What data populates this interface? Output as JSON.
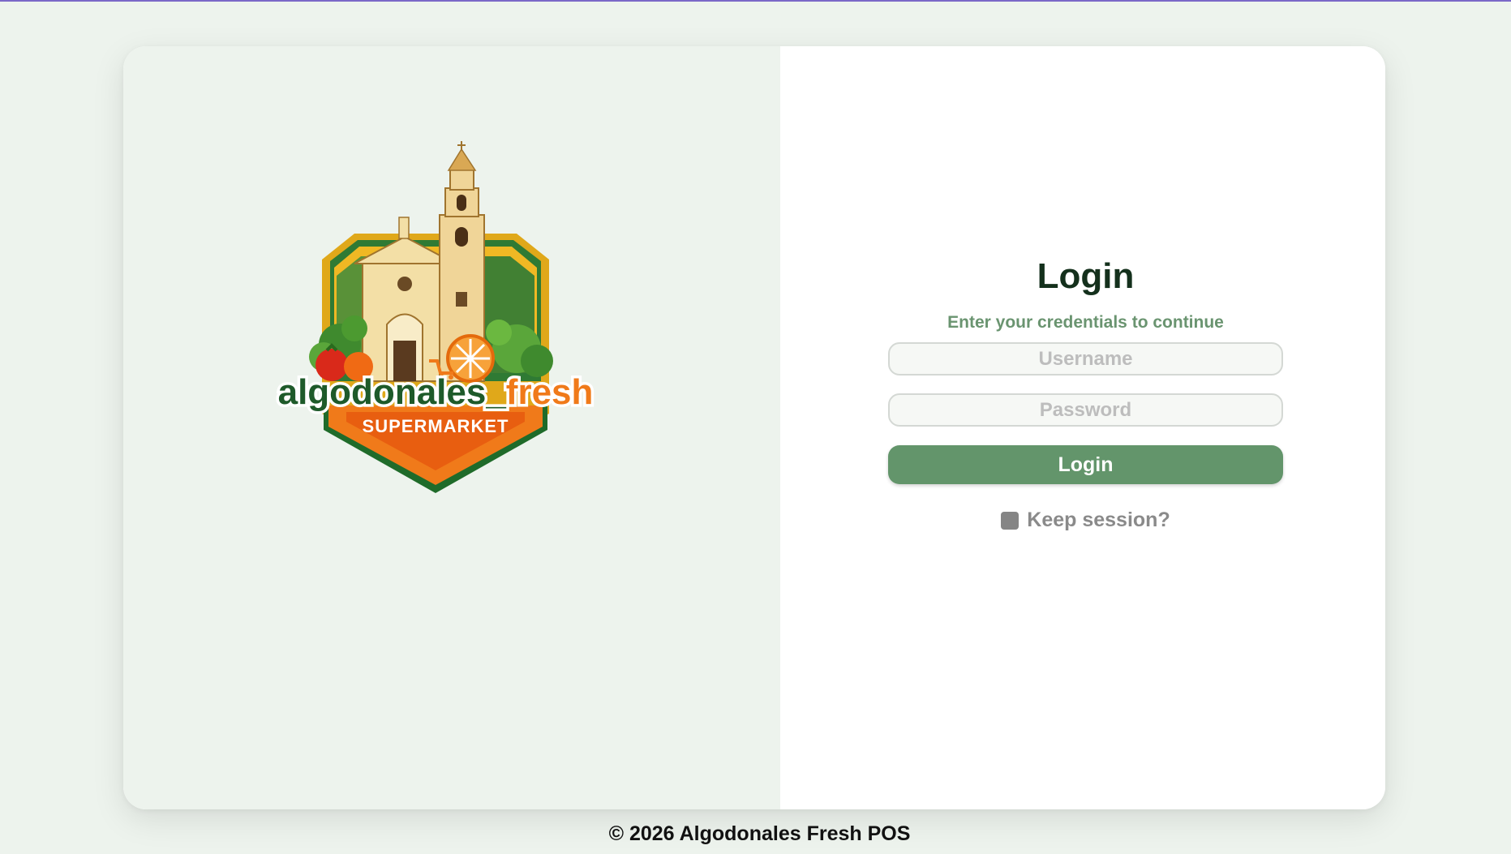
{
  "login": {
    "title": "Login",
    "subtitle": "Enter your credentials to continue",
    "username_placeholder": "Username",
    "username_value": "",
    "password_placeholder": "Password",
    "password_value": "",
    "submit_label": "Login",
    "keep_session_label": "Keep session?",
    "keep_session_checked": false
  },
  "logo": {
    "brand_text": "algodonales_fresh",
    "tagline": "SUPERMARKET",
    "icon": "church-produce-logo"
  },
  "footer": {
    "copyright": "© 2026 Algodonales Fresh POS"
  },
  "colors": {
    "background": "#edf3ed",
    "accent_green": "#63956b",
    "subtitle_green": "#6a9470",
    "brand_orange": "#f07a1a",
    "brand_dark_green": "#1e5a2a"
  }
}
